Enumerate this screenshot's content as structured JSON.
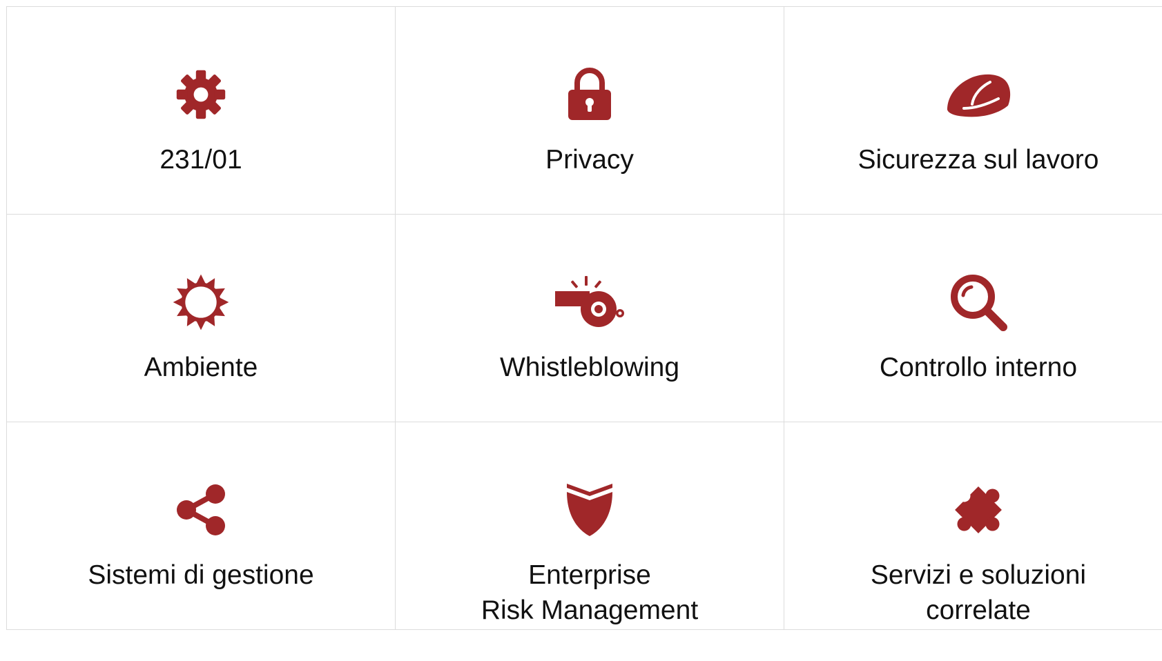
{
  "theme": {
    "icon_color": "#a02729",
    "border_color": "#dcdcdc",
    "text_color": "#111111"
  },
  "tiles": [
    {
      "icon": "gear-icon",
      "lines": [
        "231/01"
      ]
    },
    {
      "icon": "lock-icon",
      "lines": [
        "Privacy"
      ]
    },
    {
      "icon": "hard-hat-icon",
      "lines": [
        "Sicurezza sul lavoro"
      ]
    },
    {
      "icon": "sun-icon",
      "lines": [
        "Ambiente"
      ]
    },
    {
      "icon": "whistle-icon",
      "lines": [
        "Whistleblowing"
      ]
    },
    {
      "icon": "magnifier-icon",
      "lines": [
        "Controllo interno"
      ]
    },
    {
      "icon": "share-icon",
      "lines": [
        "Sistemi di gestione"
      ]
    },
    {
      "icon": "shield-icon",
      "lines": [
        "Enterprise",
        "Risk Management"
      ]
    },
    {
      "icon": "puzzle-icon",
      "lines": [
        "Servizi e soluzioni",
        "correlate"
      ]
    }
  ]
}
